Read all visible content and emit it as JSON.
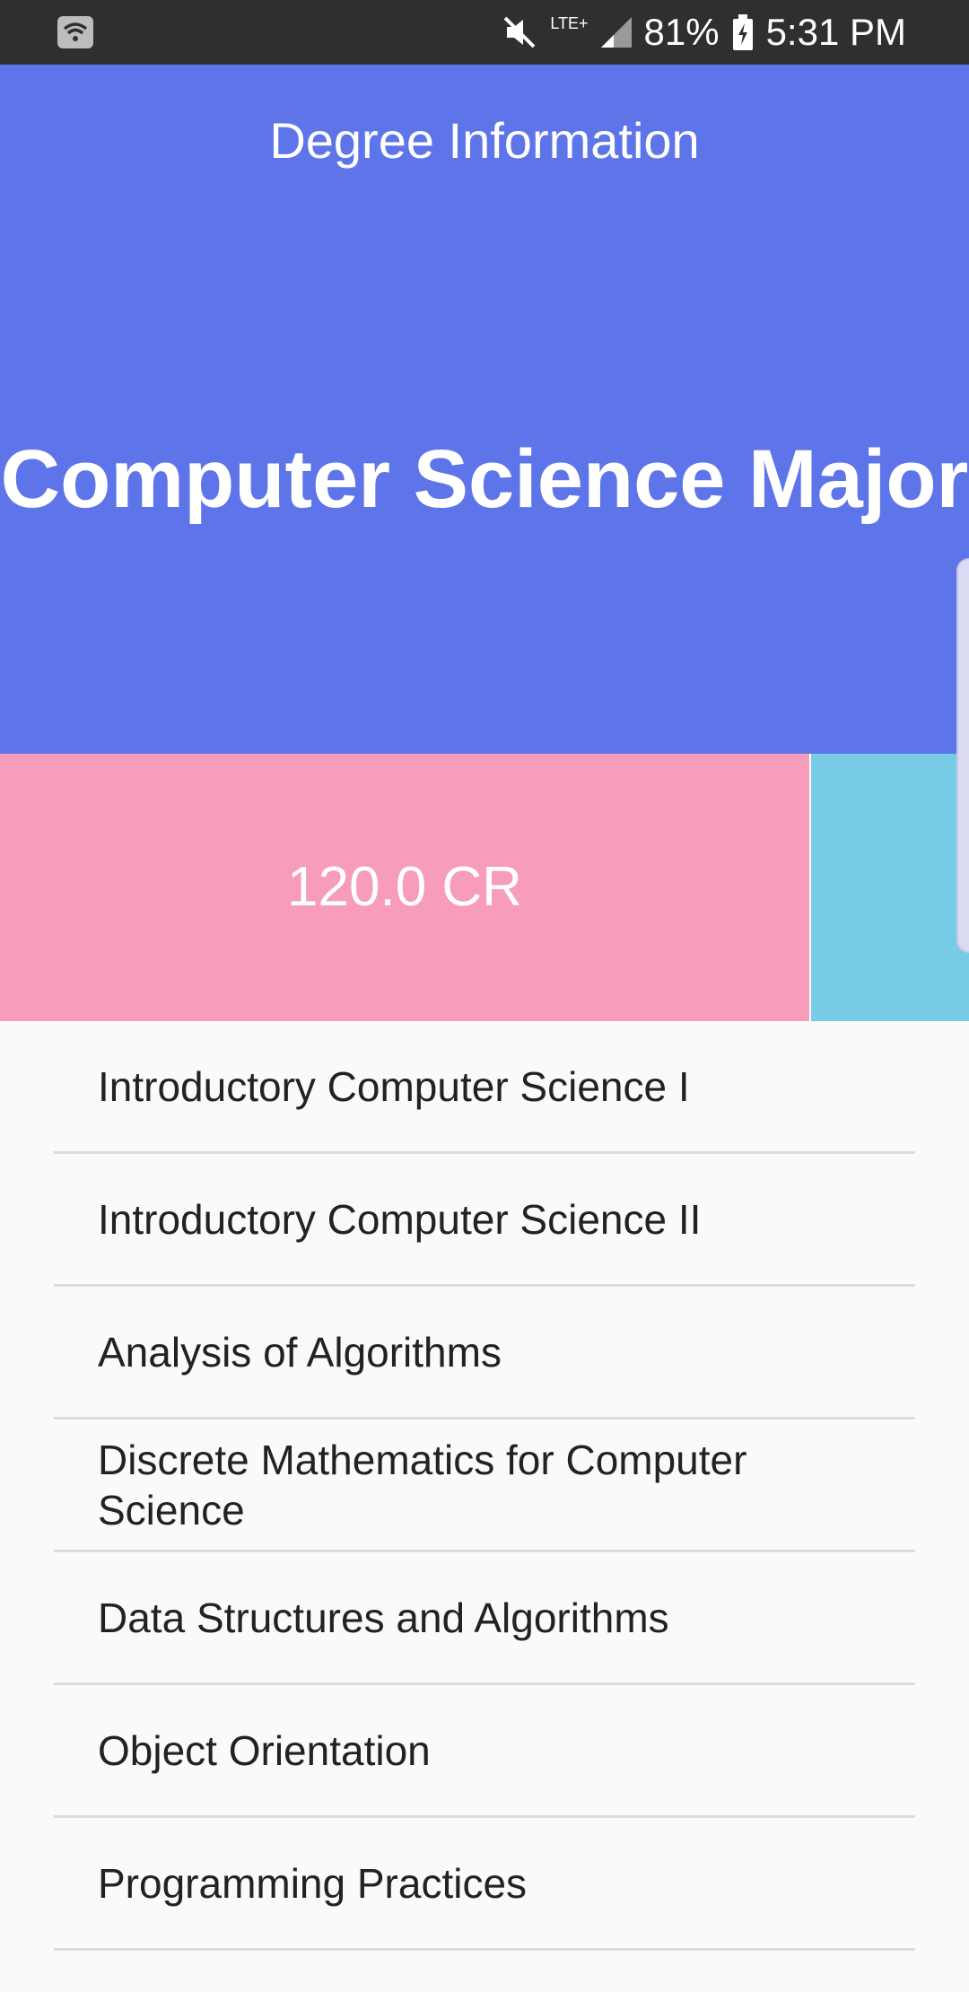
{
  "status_bar": {
    "network": "LTE+",
    "battery": "81%",
    "time": "5:31 PM"
  },
  "header": {
    "title": "Degree Information",
    "major": "Computer Science Major"
  },
  "credits": {
    "label": "120.0 CR"
  },
  "courses": [
    {
      "name": "Introductory Computer Science I"
    },
    {
      "name": "Introductory Computer Science II"
    },
    {
      "name": "Analysis of Algorithms"
    },
    {
      "name": "Discrete Mathematics for Computer Science"
    },
    {
      "name": "Data Structures and Algorithms"
    },
    {
      "name": "Object Orientation"
    },
    {
      "name": "Programming Practices"
    }
  ],
  "colors": {
    "header": "#5e74e9",
    "credits_box": "#f79cbb",
    "side_box": "#78cbe6",
    "status_bar": "#2f2f2f"
  }
}
